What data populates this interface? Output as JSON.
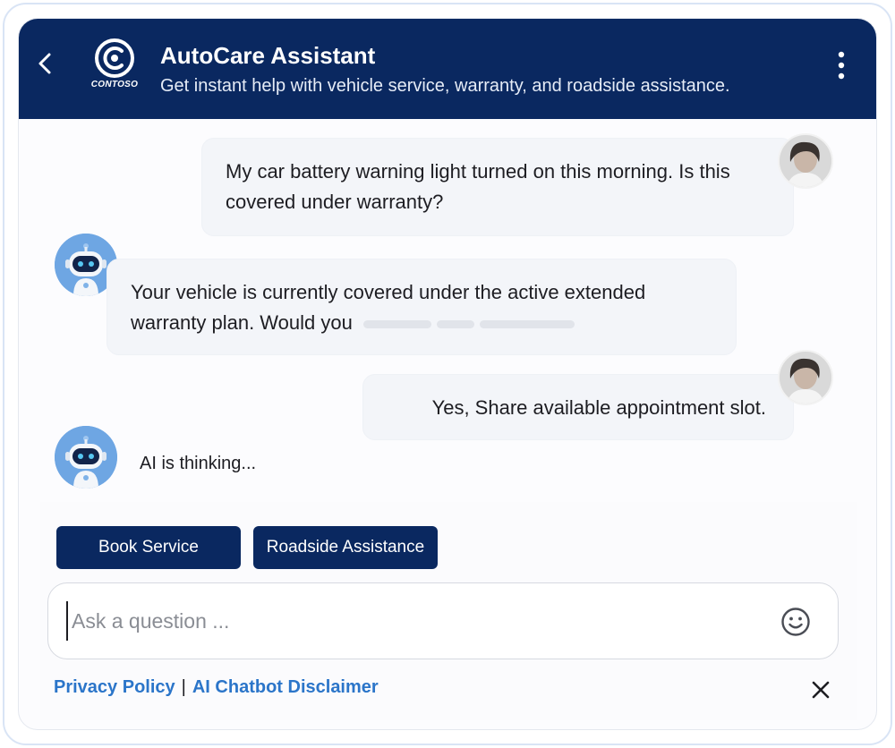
{
  "header": {
    "title": "AutoCare Assistant",
    "subtitle": "Get instant help with vehicle service, warranty, and roadside assistance.",
    "logo_text": "CONTOSO",
    "back_icon": "chevron-left-icon",
    "menu_icon": "more-vertical-icon"
  },
  "messages": [
    {
      "sender": "user",
      "text": "My car battery warning light turned on this morning. Is this covered under warranty?"
    },
    {
      "sender": "bot",
      "text": "Your vehicle is currently covered under the active extended warranty plan. Would you"
    },
    {
      "sender": "user",
      "text": "Yes, Share available appointment slot."
    }
  ],
  "status": {
    "thinking": "AI is thinking..."
  },
  "quick_actions": {
    "book_service": "Book Service",
    "roadside_assistance": "Roadside Assistance"
  },
  "input": {
    "placeholder": "Ask a question ...",
    "value": "",
    "emoji_icon": "smiley-icon"
  },
  "footer": {
    "privacy_policy": "Privacy Policy",
    "separator": "|",
    "disclaimer": "AI Chatbot Disclaimer",
    "close_icon": "close-icon"
  },
  "colors": {
    "header_bg": "#0a2860",
    "button_bg": "#0a2860",
    "link": "#2b75c9",
    "bubble_bg": "#f3f5f9"
  }
}
